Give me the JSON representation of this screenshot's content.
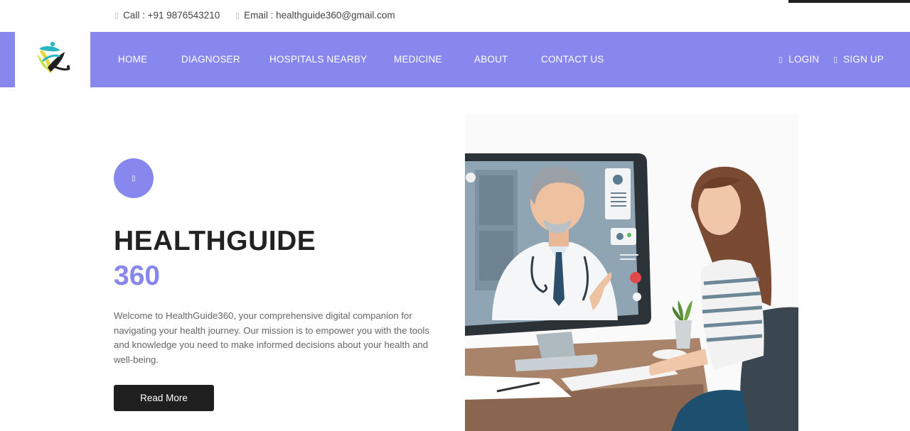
{
  "topbar": {
    "call_icon": "phone-icon",
    "call_text": "Call : +91 9876543210",
    "email_icon": "envelope-icon",
    "email_text": "Email : healthguide360@gmail.com"
  },
  "brand": {
    "logo": "healthguide360-logo"
  },
  "nav": {
    "items": [
      "HOME",
      "DIAGNOSER",
      "HOSPITALS NEARBY",
      "MEDICINE",
      "ABOUT",
      "CONTACT US"
    ],
    "login_label": "LOGIN",
    "signup_label": "SIGN UP",
    "login_icon": "user-icon",
    "signup_icon": "user-plus-icon"
  },
  "hero": {
    "badge_icon": "play-icon",
    "title": "HEALTHGUIDE",
    "subtitle": "360",
    "description": "Welcome to HealthGuide360, your comprehensive digital companion for navigating your health journey. Our mission is to empower you with the tools and knowledge you need to make informed decisions about your health and well-being.",
    "cta_label": "Read More",
    "image": "telemedicine-illustration"
  },
  "colors": {
    "accent": "#8787ee",
    "dark": "#1f1f1f",
    "text": "#666666"
  }
}
